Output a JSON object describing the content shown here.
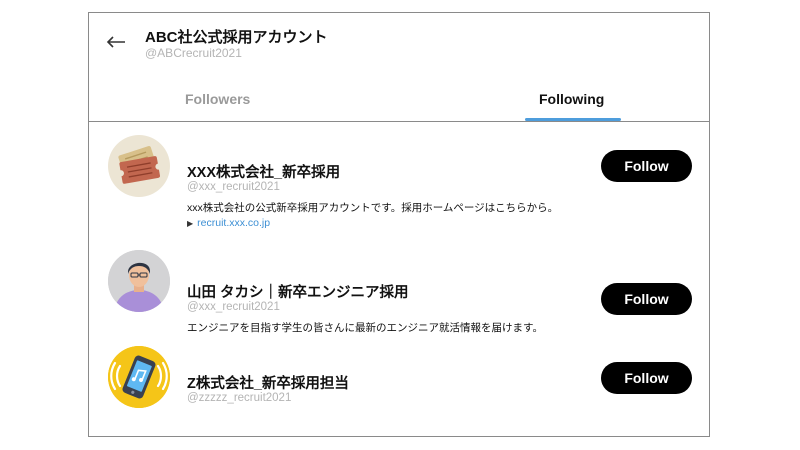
{
  "header": {
    "account_name": "ABC社公式採用アカウント",
    "account_handle": "@ABCrecruit2021"
  },
  "tabs": [
    {
      "label": "Followers",
      "active": false
    },
    {
      "label": "Following",
      "active": true
    }
  ],
  "accent_color": "#4e9ddc",
  "link_color": "#3c8fd4",
  "users": [
    {
      "name": "XXX株式会社_新卒採用",
      "handle": "@xxx_recruit2021",
      "bio": "xxx株式会社の公式新卒採用アカウントです。採用ホームページはこちらから。",
      "link": "recruit.xxx.co.jp",
      "avatar": "tickets-icon",
      "button_label": "Follow"
    },
    {
      "name": "山田 タカシ｜新卒エンジニア採用",
      "handle": "@xxx_recruit2021",
      "bio": "エンジニアを目指す学生の皆さんに最新のエンジニア就活情報を届けます。",
      "avatar": "person-icon",
      "button_label": "Follow"
    },
    {
      "name": "Z株式会社_新卒採用担当",
      "handle": "@zzzzz_recruit2021",
      "avatar": "ringing-phone-icon",
      "button_label": "Follow"
    }
  ]
}
